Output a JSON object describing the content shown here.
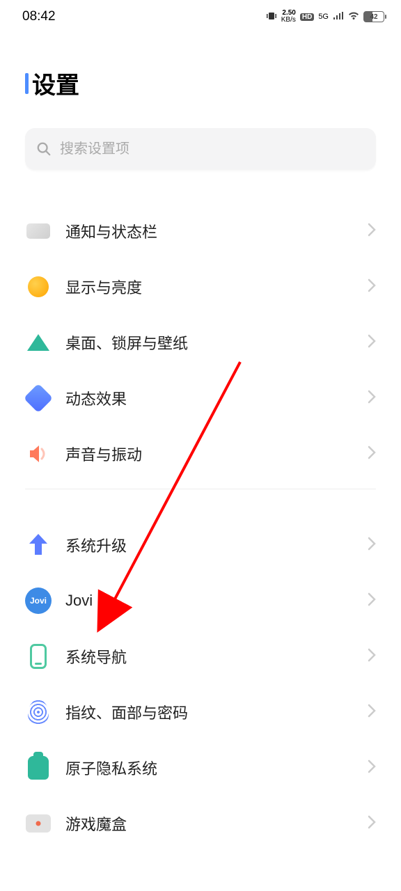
{
  "status": {
    "time": "08:42",
    "speed_value": "2.50",
    "speed_unit": "KB/s",
    "hd": "HD",
    "net": "5G",
    "battery": "42"
  },
  "header": {
    "title": "设置"
  },
  "search": {
    "placeholder": "搜索设置项"
  },
  "section1": [
    {
      "key": "notifications",
      "label": "通知与状态栏"
    },
    {
      "key": "display",
      "label": "显示与亮度"
    },
    {
      "key": "wallpaper",
      "label": "桌面、锁屏与壁纸"
    },
    {
      "key": "animation",
      "label": "动态效果"
    },
    {
      "key": "sound",
      "label": "声音与振动"
    }
  ],
  "section2": [
    {
      "key": "upgrade",
      "label": "系统升级"
    },
    {
      "key": "jovi",
      "label": "Jovi"
    },
    {
      "key": "navigation",
      "label": "系统导航"
    },
    {
      "key": "fingerprint",
      "label": "指纹、面部与密码"
    },
    {
      "key": "privacy",
      "label": "原子隐私系统"
    },
    {
      "key": "gamebox",
      "label": "游戏魔盒"
    }
  ]
}
